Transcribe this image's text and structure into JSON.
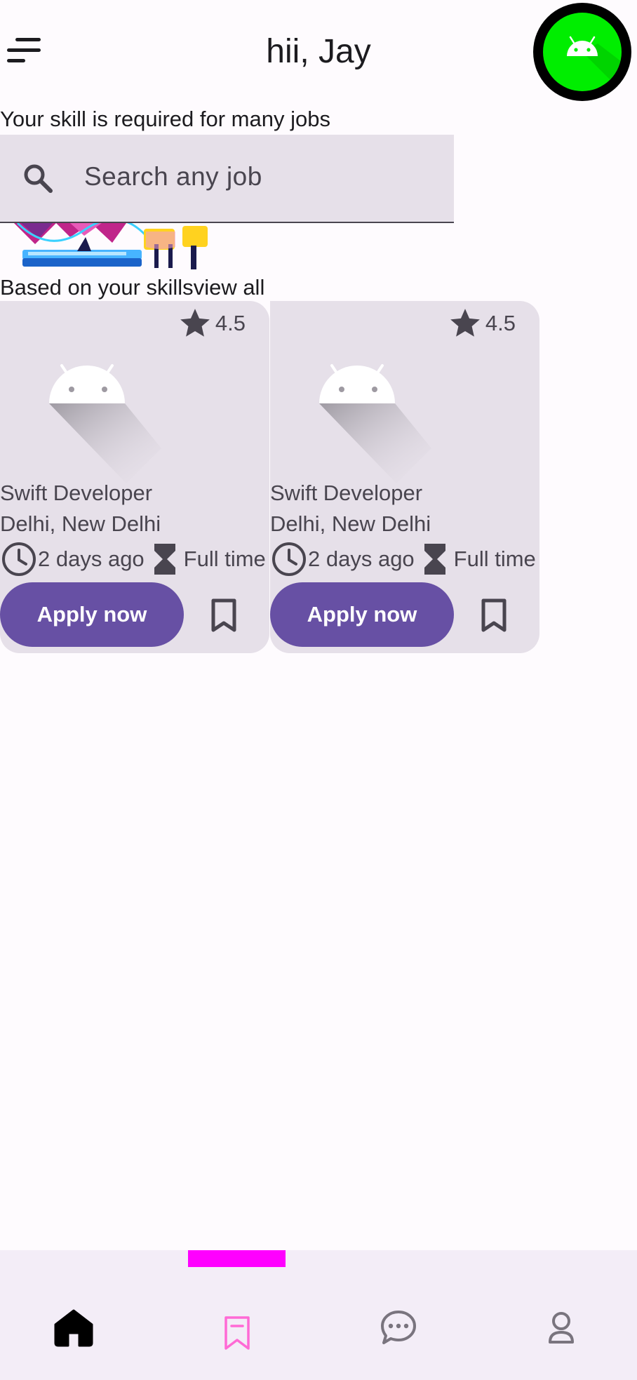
{
  "header": {
    "greeting": "hii, Jay",
    "menu_icon": "sort-menu-icon",
    "avatar_icon": "android-icon",
    "avatar_color": "#00ee00"
  },
  "subtitle": "Your skill is required for many jobs",
  "search": {
    "placeholder": "Search any job",
    "value": "",
    "icon": "search-icon"
  },
  "section": {
    "title": "Based on your skills",
    "view_all": "view all"
  },
  "jobs": [
    {
      "rating": "4.5",
      "title": "Swift Developer",
      "location": "Delhi, New Delhi",
      "posted": "2 days ago",
      "type": "Full time",
      "apply_label": "Apply now"
    },
    {
      "rating": "4.5",
      "title": "Swift Developer",
      "location": "Delhi, New Delhi",
      "posted": "2 days ago",
      "type": "Full time",
      "apply_label": "Apply now"
    }
  ],
  "bottom_nav": {
    "items": [
      "home-icon",
      "bookmark-icon",
      "chat-icon",
      "profile-icon"
    ],
    "selected": "home-icon",
    "indicator_color": "#ff00ff",
    "accent_color": "#6750a4"
  }
}
